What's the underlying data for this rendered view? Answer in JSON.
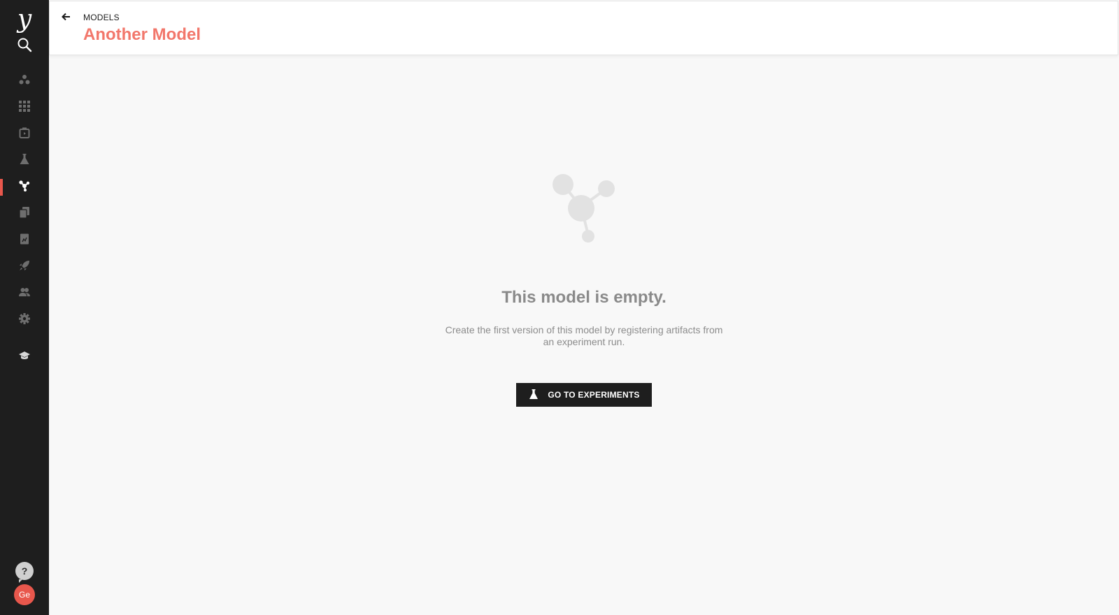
{
  "sidebar": {
    "logo": "y",
    "nav_items": [
      {
        "icon": "projects-icon",
        "label": "Projects"
      },
      {
        "icon": "datasets-icon",
        "label": "Datasets"
      },
      {
        "icon": "workspaces-icon",
        "label": "Workspaces"
      },
      {
        "icon": "experiments-flask-icon",
        "label": "Experiments"
      },
      {
        "icon": "models-icon",
        "label": "Models",
        "active": true
      },
      {
        "icon": "reports-icon",
        "label": "Reports"
      },
      {
        "icon": "notebooks-icon",
        "label": "Notebooks"
      },
      {
        "icon": "deployments-rocket-icon",
        "label": "Deployments"
      },
      {
        "icon": "users-icon",
        "label": "Users"
      },
      {
        "icon": "settings-gear-icon",
        "label": "Settings"
      },
      {
        "icon": "learn-graduation-cap-icon",
        "label": "Learn"
      }
    ],
    "help_label": "?",
    "avatar_initials": "Ge"
  },
  "header": {
    "breadcrumb": "MODELS",
    "title": "Another Model"
  },
  "empty_state": {
    "title": "This model is empty.",
    "description": "Create the first version of this model by registering artifacts from an experiment run.",
    "button_label": "GO TO EXPERIMENTS"
  },
  "colors": {
    "sidebar_bg": "#1e1e1e",
    "accent": "#e8574c",
    "title": "#f2776b",
    "page_bg": "#f8f8f8",
    "button_bg": "#1e1e1e"
  }
}
